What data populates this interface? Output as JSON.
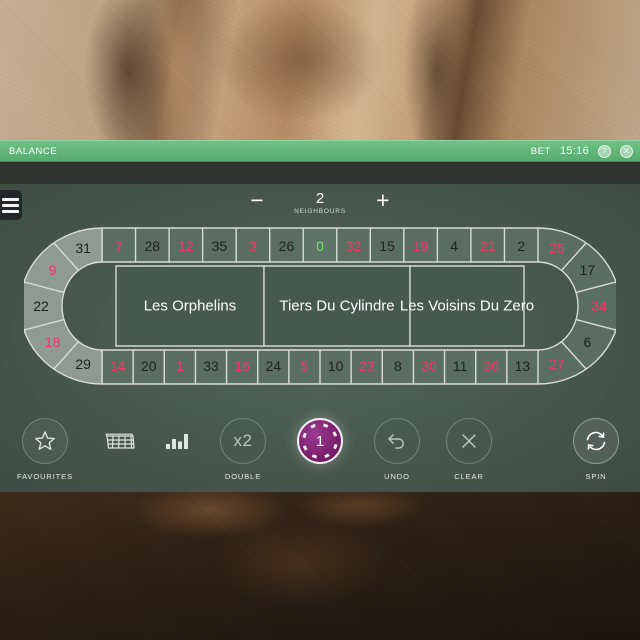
{
  "status_bar": {
    "balance_label": "BALANCE",
    "bet_label": "BET",
    "clock": "15:16",
    "help_icon": "question-mark-icon",
    "close_icon": "close-icon"
  },
  "menu": {
    "icon": "hamburger-menu-icon"
  },
  "neighbours": {
    "minus_label": "−",
    "plus_label": "+",
    "value": "2",
    "caption": "NEIGHBOURS"
  },
  "racetrack": {
    "sectors": [
      {
        "key": "orphelins",
        "label": "Les Orphelins"
      },
      {
        "key": "tiers",
        "label": "Tiers Du Cylindre"
      },
      {
        "key": "voisins",
        "label": "Les Voisins Du Zero"
      }
    ],
    "left_arc": [
      {
        "n": "29",
        "color": "black",
        "highlighted": true
      },
      {
        "n": "18",
        "color": "red",
        "highlighted": true
      },
      {
        "n": "22",
        "color": "black",
        "highlighted": true
      },
      {
        "n": "9",
        "color": "red",
        "highlighted": true
      },
      {
        "n": "31",
        "color": "black",
        "highlighted": true
      }
    ],
    "top_row": [
      {
        "n": "7",
        "color": "red"
      },
      {
        "n": "28",
        "color": "black"
      },
      {
        "n": "12",
        "color": "red"
      },
      {
        "n": "35",
        "color": "black"
      },
      {
        "n": "3",
        "color": "red"
      },
      {
        "n": "26",
        "color": "black"
      },
      {
        "n": "0",
        "color": "green"
      },
      {
        "n": "32",
        "color": "red"
      },
      {
        "n": "15",
        "color": "black"
      },
      {
        "n": "19",
        "color": "red"
      },
      {
        "n": "4",
        "color": "black"
      },
      {
        "n": "21",
        "color": "red"
      },
      {
        "n": "2",
        "color": "black"
      }
    ],
    "right_arc": [
      {
        "n": "25",
        "color": "red"
      },
      {
        "n": "17",
        "color": "black"
      },
      {
        "n": "34",
        "color": "red"
      },
      {
        "n": "6",
        "color": "black"
      },
      {
        "n": "27",
        "color": "red"
      }
    ],
    "bottom_row": [
      {
        "n": "14",
        "color": "red"
      },
      {
        "n": "20",
        "color": "black"
      },
      {
        "n": "1",
        "color": "red"
      },
      {
        "n": "33",
        "color": "black"
      },
      {
        "n": "16",
        "color": "red"
      },
      {
        "n": "24",
        "color": "black"
      },
      {
        "n": "5",
        "color": "red"
      },
      {
        "n": "10",
        "color": "black"
      },
      {
        "n": "23",
        "color": "red"
      },
      {
        "n": "8",
        "color": "black"
      },
      {
        "n": "30",
        "color": "red"
      },
      {
        "n": "11",
        "color": "black"
      },
      {
        "n": "36",
        "color": "red"
      },
      {
        "n": "13",
        "color": "black"
      }
    ]
  },
  "toolbar": {
    "favourites_label": "FAVOURITES",
    "favourites_icon": "star-icon",
    "table_icon": "table-grid-icon",
    "stats_icon": "bar-chart-icon",
    "double_label": "DOUBLE",
    "double_icon": "x2-icon",
    "chip_value": "1",
    "undo_label": "UNDO",
    "undo_icon": "undo-arrow-icon",
    "clear_label": "CLEAR",
    "clear_icon": "close-x-icon",
    "spin_label": "SPIN",
    "spin_icon": "refresh-circular-arrows-icon"
  },
  "colors": {
    "accent_green": "#62b679",
    "felt": "#47594f",
    "red_number": "#f0376a",
    "zero_green": "#73e36b",
    "chip_purple": "#7c2270"
  }
}
